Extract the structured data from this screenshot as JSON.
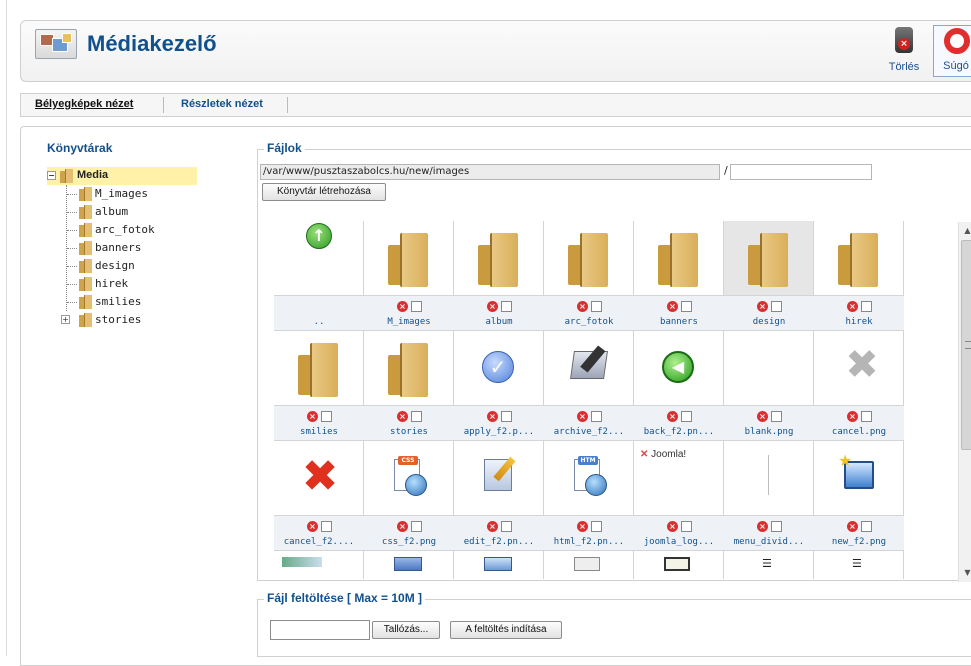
{
  "header": {
    "title": "Médiakezelő"
  },
  "toolbar": {
    "delete_label": "Törlés",
    "help_label": "Súgó"
  },
  "tabs": [
    {
      "label": "Bélyegképek nézet",
      "active": true
    },
    {
      "label": "Részletek nézet",
      "active": false
    }
  ],
  "libraries": {
    "title": "Könyvtárak",
    "root": "Media",
    "items": [
      "M_images",
      "album",
      "arc_fotok",
      "banners",
      "design",
      "hirek",
      "smilies",
      "stories"
    ]
  },
  "files": {
    "legend": "Fájlok",
    "path": "/var/www/pusztaszabolcs.hu/new/images",
    "slash": "/",
    "new_dir_value": "",
    "create_dir_label": "Könyvtár létrehozása",
    "grid": [
      {
        "name": "..",
        "icon": "up-icon"
      },
      {
        "name": "M_images",
        "icon": "folder-icon"
      },
      {
        "name": "album",
        "icon": "folder-icon"
      },
      {
        "name": "arc_fotok",
        "icon": "folder-icon"
      },
      {
        "name": "banners",
        "icon": "folder-icon"
      },
      {
        "name": "design",
        "icon": "folder-icon",
        "selected": true
      },
      {
        "name": "hirek",
        "icon": "folder-icon"
      },
      {
        "name": "smilies",
        "icon": "folder-icon"
      },
      {
        "name": "stories",
        "icon": "folder-icon"
      },
      {
        "name": "apply_f2.p...",
        "icon": "apply-icon"
      },
      {
        "name": "archive_f2...",
        "icon": "archive-icon"
      },
      {
        "name": "back_f2.pn...",
        "icon": "back-icon"
      },
      {
        "name": "blank.png",
        "icon": "blank-icon"
      },
      {
        "name": "cancel.png",
        "icon": "cancel-gray-icon"
      },
      {
        "name": "cancel_f2....",
        "icon": "cancel-red-icon"
      },
      {
        "name": "css_f2.png",
        "icon": "css-doc-icon"
      },
      {
        "name": "edit_f2.pn...",
        "icon": "edit-icon"
      },
      {
        "name": "html_f2.pn...",
        "icon": "html-doc-icon"
      },
      {
        "name": "joomla_log...",
        "icon": "joomla-logo-icon"
      },
      {
        "name": "menu_divid...",
        "icon": "menu-divider-icon"
      },
      {
        "name": "new_f2.png",
        "icon": "new-icon"
      }
    ],
    "joomla_text": "Joomla!"
  },
  "upload": {
    "legend": "Fájl feltöltése [ Max = 10M ]",
    "browse_label": "Tallózás...",
    "upload_label": "A feltöltés indítása"
  }
}
